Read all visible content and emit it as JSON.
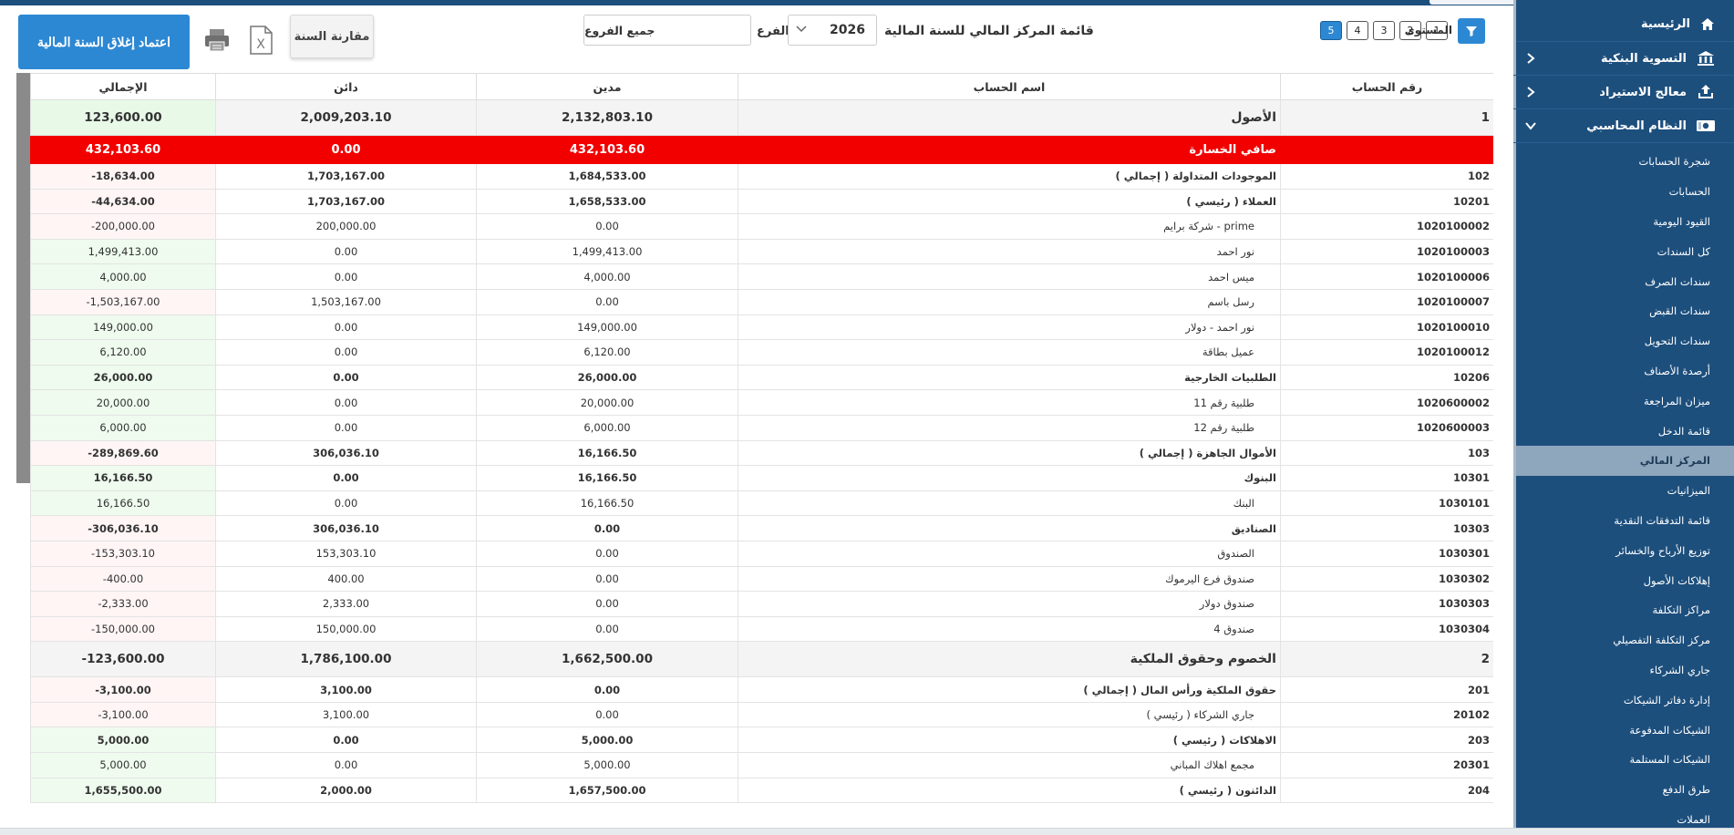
{
  "sidebar": {
    "home": "الرئيسية",
    "items": [
      {
        "label": "التسوية البنكية",
        "icon": "bank-icon"
      },
      {
        "label": "معالج الاستيراد",
        "icon": "upload-icon"
      },
      {
        "label": "النظام المحاسبي",
        "icon": "money-icon"
      }
    ],
    "subitems": [
      "شجرة الحسابات",
      "الحسابات",
      "القيود اليومية",
      "كل السندات",
      "سندات الصرف",
      "سندات القبض",
      "سندات التحويل",
      "أرصدة الأصناف",
      "ميزان المراجعة",
      "قائمة الدخل",
      "المركز المالي",
      "الميزانيات",
      "قائمة التدفقات النقدية",
      "توزيع الأرباح والخسائر",
      "إهلاكات الأصول",
      "مراكز التكلفة",
      "مركز التكلفة التفصيلي",
      "جاري الشركاء",
      "إدارة دفاتر الشيكات",
      "الشيكات المدفوعة",
      "الشيكات المستلمة",
      "طرق الدفع",
      "العملات"
    ],
    "active_index": 10
  },
  "toolbar": {
    "close_year": "اعتماد إغلاق السنة المالية",
    "compare_year": "مقارنة السنة",
    "branch_value": "جميع الفروع",
    "branch_label": "الفرع",
    "year_value": "2026",
    "title": "قائمة المركز المالي للسنة المالية",
    "level_label": "المستوى",
    "levels": [
      "1",
      "2",
      "3",
      "4",
      "5"
    ],
    "active_level": "5"
  },
  "table": {
    "headers": [
      "رقم الحساب",
      "اسم الحساب",
      "مدين",
      "دائن",
      "الإجمالي"
    ],
    "rows": [
      {
        "type": "top",
        "code": "1",
        "name": "الأصول",
        "debit": "2,132,803.10",
        "credit": "2,009,203.10",
        "total": "123,600.00",
        "sign": "pos"
      },
      {
        "type": "loss",
        "code": "",
        "name": "صافي الخسارة",
        "debit": "432,103.60",
        "credit": "0.00",
        "total": "432,103.60",
        "sign": "pos"
      },
      {
        "type": "bold",
        "code": "102",
        "name": "الموجودات المتداولة ( إجمالي )",
        "debit": "1,684,533.00",
        "credit": "1,703,167.00",
        "total": "-18,634.00",
        "sign": "neg"
      },
      {
        "type": "bold",
        "code": "10201",
        "name": "العملاء ( رئيسي )",
        "debit": "1,658,533.00",
        "credit": "1,703,167.00",
        "total": "-44,634.00",
        "sign": "neg"
      },
      {
        "type": "leaf",
        "code": "1020100002",
        "name": "prime - شركة برايم",
        "debit": "0.00",
        "credit": "200,000.00",
        "total": "-200,000.00",
        "sign": "neg"
      },
      {
        "type": "leaf",
        "code": "1020100003",
        "name": "نور احمد",
        "debit": "1,499,413.00",
        "credit": "0.00",
        "total": "1,499,413.00",
        "sign": "pos"
      },
      {
        "type": "leaf",
        "code": "1020100006",
        "name": "ميس احمد",
        "debit": "4,000.00",
        "credit": "0.00",
        "total": "4,000.00",
        "sign": "pos"
      },
      {
        "type": "leaf",
        "code": "1020100007",
        "name": "رسل باسم",
        "debit": "0.00",
        "credit": "1,503,167.00",
        "total": "-1,503,167.00",
        "sign": "neg"
      },
      {
        "type": "leaf",
        "code": "1020100010",
        "name": "نور احمد - دولار",
        "debit": "149,000.00",
        "credit": "0.00",
        "total": "149,000.00",
        "sign": "pos"
      },
      {
        "type": "leaf",
        "code": "1020100012",
        "name": "عميل بطاقة",
        "debit": "6,120.00",
        "credit": "0.00",
        "total": "6,120.00",
        "sign": "pos"
      },
      {
        "type": "bold",
        "code": "10206",
        "name": "الطلبيات الخارجية",
        "debit": "26,000.00",
        "credit": "0.00",
        "total": "26,000.00",
        "sign": "pos"
      },
      {
        "type": "leaf",
        "code": "1020600002",
        "name": "طلبية رقم 11",
        "debit": "20,000.00",
        "credit": "0.00",
        "total": "20,000.00",
        "sign": "pos"
      },
      {
        "type": "leaf",
        "code": "1020600003",
        "name": "طلبية رقم 12",
        "debit": "6,000.00",
        "credit": "0.00",
        "total": "6,000.00",
        "sign": "pos"
      },
      {
        "type": "bold",
        "code": "103",
        "name": "الأموال الجاهزة ( إجمالي )",
        "debit": "16,166.50",
        "credit": "306,036.10",
        "total": "-289,869.60",
        "sign": "neg"
      },
      {
        "type": "bold",
        "code": "10301",
        "name": "البنوك",
        "debit": "16,166.50",
        "credit": "0.00",
        "total": "16,166.50",
        "sign": "pos"
      },
      {
        "type": "leaf",
        "code": "1030101",
        "name": "البنك",
        "debit": "16,166.50",
        "credit": "0.00",
        "total": "16,166.50",
        "sign": "pos"
      },
      {
        "type": "bold",
        "code": "10303",
        "name": "الصناديق",
        "debit": "0.00",
        "credit": "306,036.10",
        "total": "-306,036.10",
        "sign": "neg"
      },
      {
        "type": "leaf",
        "code": "1030301",
        "name": "الصندوق",
        "debit": "0.00",
        "credit": "153,303.10",
        "total": "-153,303.10",
        "sign": "neg"
      },
      {
        "type": "leaf",
        "code": "1030302",
        "name": "صندوق فرع اليرموك",
        "debit": "0.00",
        "credit": "400.00",
        "total": "-400.00",
        "sign": "neg"
      },
      {
        "type": "leaf",
        "code": "1030303",
        "name": "صندوق دولار",
        "debit": "0.00",
        "credit": "2,333.00",
        "total": "-2,333.00",
        "sign": "neg"
      },
      {
        "type": "leaf",
        "code": "1030304",
        "name": "صندوق 4",
        "debit": "0.00",
        "credit": "150,000.00",
        "total": "-150,000.00",
        "sign": "neg"
      },
      {
        "type": "top",
        "code": "2",
        "name": "الخصوم وحقوق الملكية",
        "debit": "1,662,500.00",
        "credit": "1,786,100.00",
        "total": "-123,600.00",
        "sign": "neg"
      },
      {
        "type": "bold",
        "code": "201",
        "name": "حقوق الملكية ورأس المال ( إجمالي )",
        "debit": "0.00",
        "credit": "3,100.00",
        "total": "-3,100.00",
        "sign": "neg"
      },
      {
        "type": "leaf",
        "code": "20102",
        "name": "جاري الشركاء ( رئيسي )",
        "debit": "0.00",
        "credit": "3,100.00",
        "total": "-3,100.00",
        "sign": "neg"
      },
      {
        "type": "bold",
        "code": "203",
        "name": "الاهلاكات ( رئيسي )",
        "debit": "5,000.00",
        "credit": "0.00",
        "total": "5,000.00",
        "sign": "pos"
      },
      {
        "type": "leaf",
        "code": "20301",
        "name": "مجمع اهلاك المباني",
        "debit": "5,000.00",
        "credit": "0.00",
        "total": "5,000.00",
        "sign": "pos"
      },
      {
        "type": "bold",
        "code": "204",
        "name": "الدائنون ( رئيسي )",
        "debit": "1,657,500.00",
        "credit": "2,000.00",
        "total": "1,655,500.00",
        "sign": "pos"
      }
    ]
  }
}
